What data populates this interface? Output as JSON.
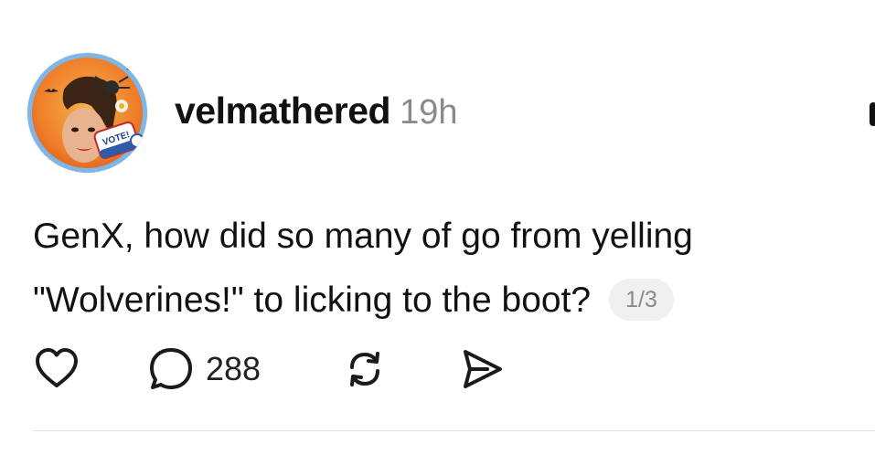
{
  "post": {
    "author": {
      "username": "velmathered",
      "avatar_badge_text": "VOTE!"
    },
    "timestamp": "19h",
    "text_lines": [
      "GenX, how did so many of go from yelling",
      "\"Wolverines!\" to licking to the boot?"
    ],
    "page_indicator": "1/3",
    "actions": {
      "like_icon": "heart-icon",
      "reply_icon": "speech-bubble-icon",
      "reply_count": "288",
      "repost_icon": "repost-icon",
      "share_icon": "send-icon"
    }
  },
  "colors": {
    "text": "#111111",
    "muted": "#8a8a8a",
    "badge_bg": "#f0f0f0",
    "divider": "#e2e2e2"
  }
}
